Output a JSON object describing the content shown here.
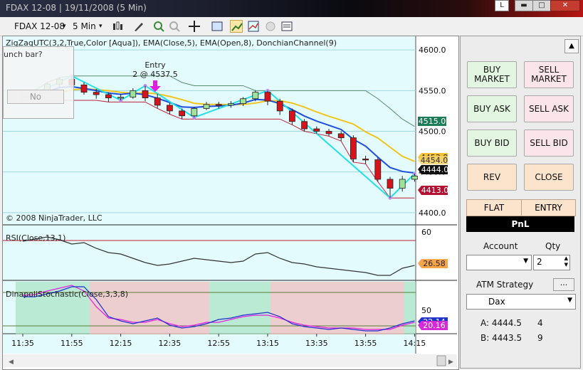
{
  "window": {
    "title": "FDAX 12-08 | 19/11/2008 (5 Min)",
    "l_button": "L",
    "min_glyph": "▬",
    "max_glyph": "□",
    "close_glyph": "✕"
  },
  "toolbar": {
    "instrument": "FDAX 12-08",
    "interval": "5 Min",
    "caret": "▾"
  },
  "popup": {
    "question": "unch bar?",
    "no_label": "No"
  },
  "chart": {
    "indicators_label": "ZigZagUTC(3,2,True,Color [Aqua]), EMA(Close,5), EMA(Open,8), DonchianChannel(9)",
    "entry_label": "Entry",
    "entry_qty_label": "2 @ 4537.5",
    "copyright": "© 2008 NinjaTrader, LLC",
    "rsi_label": "RSI(Close,13,1)",
    "stoch_label": "DinapoliStochastic(Close,3,3,8)",
    "price_axis": [
      "4600.0",
      "4550.0",
      "4500.0",
      "4450.0",
      "4400.0"
    ],
    "rsi_axis": [
      "60"
    ],
    "stoch_axis": [
      "50"
    ],
    "time_axis": [
      "11:35",
      "11:55",
      "12:15",
      "12:35",
      "12:55",
      "13:15",
      "13:35",
      "13:55",
      "14:15"
    ],
    "price_tags": {
      "green": "4515.0",
      "yellow": "4453.8",
      "yellow2": "4454.0",
      "black": "4444.0",
      "red": "4413.0",
      "rsi": "26.58",
      "stoch_blue": "22.14",
      "stoch_pink": "20.16"
    },
    "colors": {
      "background": "#e4fbfd",
      "zigzag": "#22e0e8",
      "ema_close": "#1f4fe0",
      "ema_open": "#f1c419",
      "donchian": "#c21d3a",
      "bull": "#9fe29a",
      "bear": "#d6131b"
    },
    "chart_data": {
      "type": "candlestick",
      "x": [
        "11:35",
        "11:40",
        "11:45",
        "11:50",
        "11:55",
        "12:00",
        "12:05",
        "12:10",
        "12:15",
        "12:20",
        "12:25",
        "12:30",
        "12:35",
        "12:40",
        "12:45",
        "12:50",
        "12:55",
        "13:00",
        "13:05",
        "13:10",
        "13:15",
        "13:20",
        "13:25",
        "13:30",
        "13:35",
        "13:40",
        "13:45",
        "13:50",
        "13:55",
        "14:00",
        "14:05",
        "14:10",
        "14:15"
      ],
      "open": [
        4543,
        4542,
        4548,
        4558,
        4564,
        4557,
        4548,
        4545,
        4541,
        4542,
        4550,
        4541,
        4532,
        4525,
        4519,
        4528,
        4533,
        4532,
        4534,
        4540,
        4548,
        4537,
        4525,
        4512,
        4503,
        4500,
        4497,
        4492,
        4466,
        4465,
        4441,
        4430,
        4441
      ],
      "close": [
        4542,
        4548,
        4558,
        4564,
        4557,
        4548,
        4545,
        4541,
        4542,
        4550,
        4541,
        4532,
        4525,
        4519,
        4528,
        4533,
        4532,
        4534,
        4540,
        4548,
        4537,
        4525,
        4512,
        4503,
        4500,
        4497,
        4492,
        4466,
        4465,
        4441,
        4430,
        4441,
        4445
      ],
      "high": [
        4546,
        4550,
        4560,
        4566,
        4568,
        4560,
        4552,
        4548,
        4546,
        4553,
        4556,
        4546,
        4535,
        4528,
        4530,
        4536,
        4536,
        4537,
        4542,
        4550,
        4550,
        4540,
        4528,
        4515,
        4506,
        4503,
        4500,
        4495,
        4470,
        4468,
        4444,
        4445,
        4448
      ],
      "low": [
        4538,
        4539,
        4545,
        4555,
        4552,
        4545,
        4540,
        4536,
        4538,
        4540,
        4537,
        4528,
        4521,
        4515,
        4517,
        4526,
        4528,
        4529,
        4531,
        4537,
        4532,
        4520,
        4508,
        4500,
        4497,
        4494,
        4488,
        4462,
        4460,
        4438,
        4418,
        4426,
        4438
      ],
      "ylim": [
        4385,
        4615
      ]
    }
  },
  "panel": {
    "buy_market": "BUY MARKET",
    "sell_market": "SELL MARKET",
    "buy_ask": "BUY ASK",
    "sell_ask": "SELL ASK",
    "buy_bid": "BUY BID",
    "sell_bid": "SELL BID",
    "rev": "REV",
    "close": "CLOSE",
    "flat": "FLAT",
    "entry": "ENTRY",
    "pnl": "PnL",
    "account_label": "Account",
    "qty_label": "Qty",
    "qty_value": "2",
    "atm_label": "ATM Strategy",
    "atm_more": "...",
    "atm_value": "Dax",
    "ask_label": "A: 4444.5",
    "ask_size": "4",
    "bid_label": "B: 4443.5",
    "bid_size": "9",
    "up_glyph": "▲",
    "down_glyph": "▼"
  }
}
